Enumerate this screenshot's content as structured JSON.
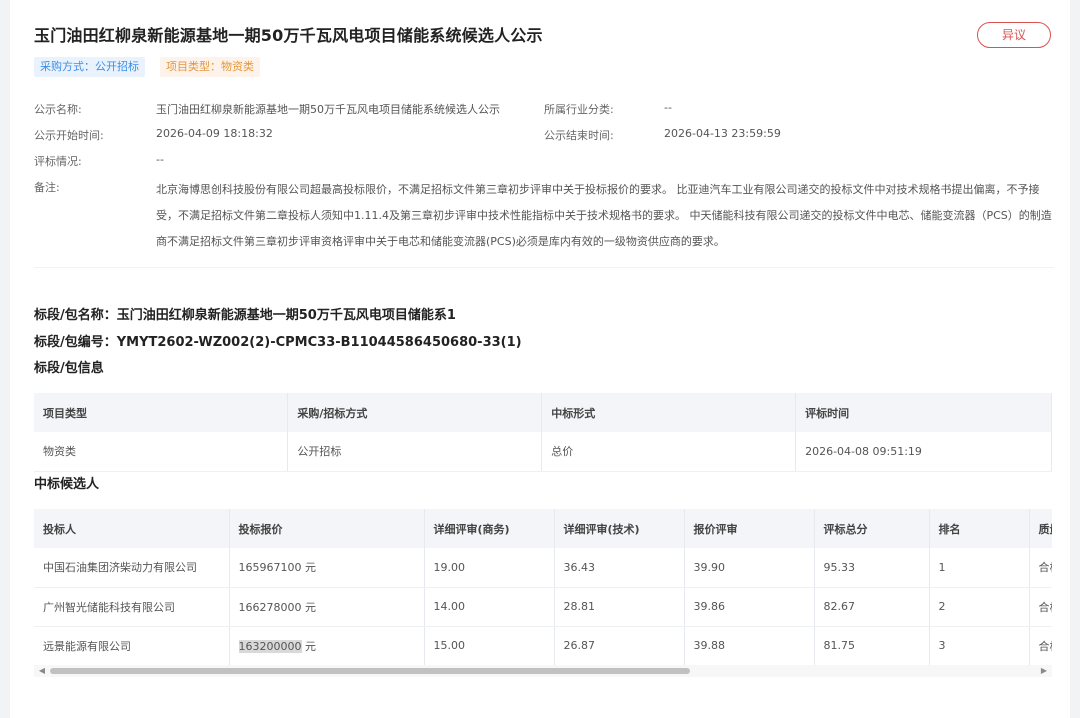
{
  "header": {
    "title": "玉门油田红柳泉新能源基地一期50万千瓦风电项目储能系统候选人公示",
    "objection_label": "异议",
    "tags": [
      "采购方式：公开招标",
      "项目类型：物资类"
    ]
  },
  "info": {
    "name_label": "公示名称:",
    "name_value": "玉门油田红柳泉新能源基地一期50万千瓦风电项目储能系统候选人公示",
    "industry_label": "所属行业分类:",
    "industry_value": "--",
    "start_label": "公示开始时间:",
    "start_value": "2026-04-09 18:18:32",
    "end_label": "公示结束时间:",
    "end_value": "2026-04-13 23:59:59",
    "eval_label": "评标情况:",
    "eval_value": "--",
    "remark_label": "备注:",
    "remark_value": "北京海博思创科技股份有限公司超最高投标限价，不满足招标文件第三章初步评审中关于投标报价的要求。 比亚迪汽车工业有限公司递交的投标文件中对技术规格书提出偏离，不予接受，不满足招标文件第二章投标人须知中1.11.4及第三章初步评审中技术性能指标中关于技术规格书的要求。 中天储能科技有限公司递交的投标文件中电芯、储能变流器（PCS）的制造商不满足招标文件第三章初步评审资格评审中关于电芯和储能变流器(PCS)必须是库内有效的一级物资供应商的要求。"
  },
  "package": {
    "name_line": "标段/包名称：玉门油田红柳泉新能源基地一期50万千瓦风电项目储能系1",
    "code_line": "标段/包编号：YMYT2602-WZ002(2)-CPMC33-B11044586450680-33(1)",
    "info_title": "标段/包信息",
    "headers": [
      "项目类型",
      "采购/招标方式",
      "中标形式",
      "评标时间"
    ],
    "row": [
      "物资类",
      "公开招标",
      "总价",
      "2026-04-08 09:51:19"
    ]
  },
  "candidates": {
    "title": "中标候选人",
    "headers": [
      "投标人",
      "投标报价",
      "详细评审(商务)",
      "详细评审(技术)",
      "报价评审",
      "评标总分",
      "排名",
      "质量"
    ],
    "rows": [
      [
        "中国石油集团济柴动力有限公司",
        "165967100",
        "元",
        "19.00",
        "36.43",
        "39.90",
        "95.33",
        "1",
        "合格"
      ],
      [
        "广州智光储能科技有限公司",
        "166278000",
        "元",
        "14.00",
        "28.81",
        "39.86",
        "82.67",
        "2",
        "合格"
      ],
      [
        "远景能源有限公司",
        "163200000",
        "元",
        "15.00",
        "26.87",
        "39.88",
        "81.75",
        "3",
        "合格"
      ]
    ]
  }
}
